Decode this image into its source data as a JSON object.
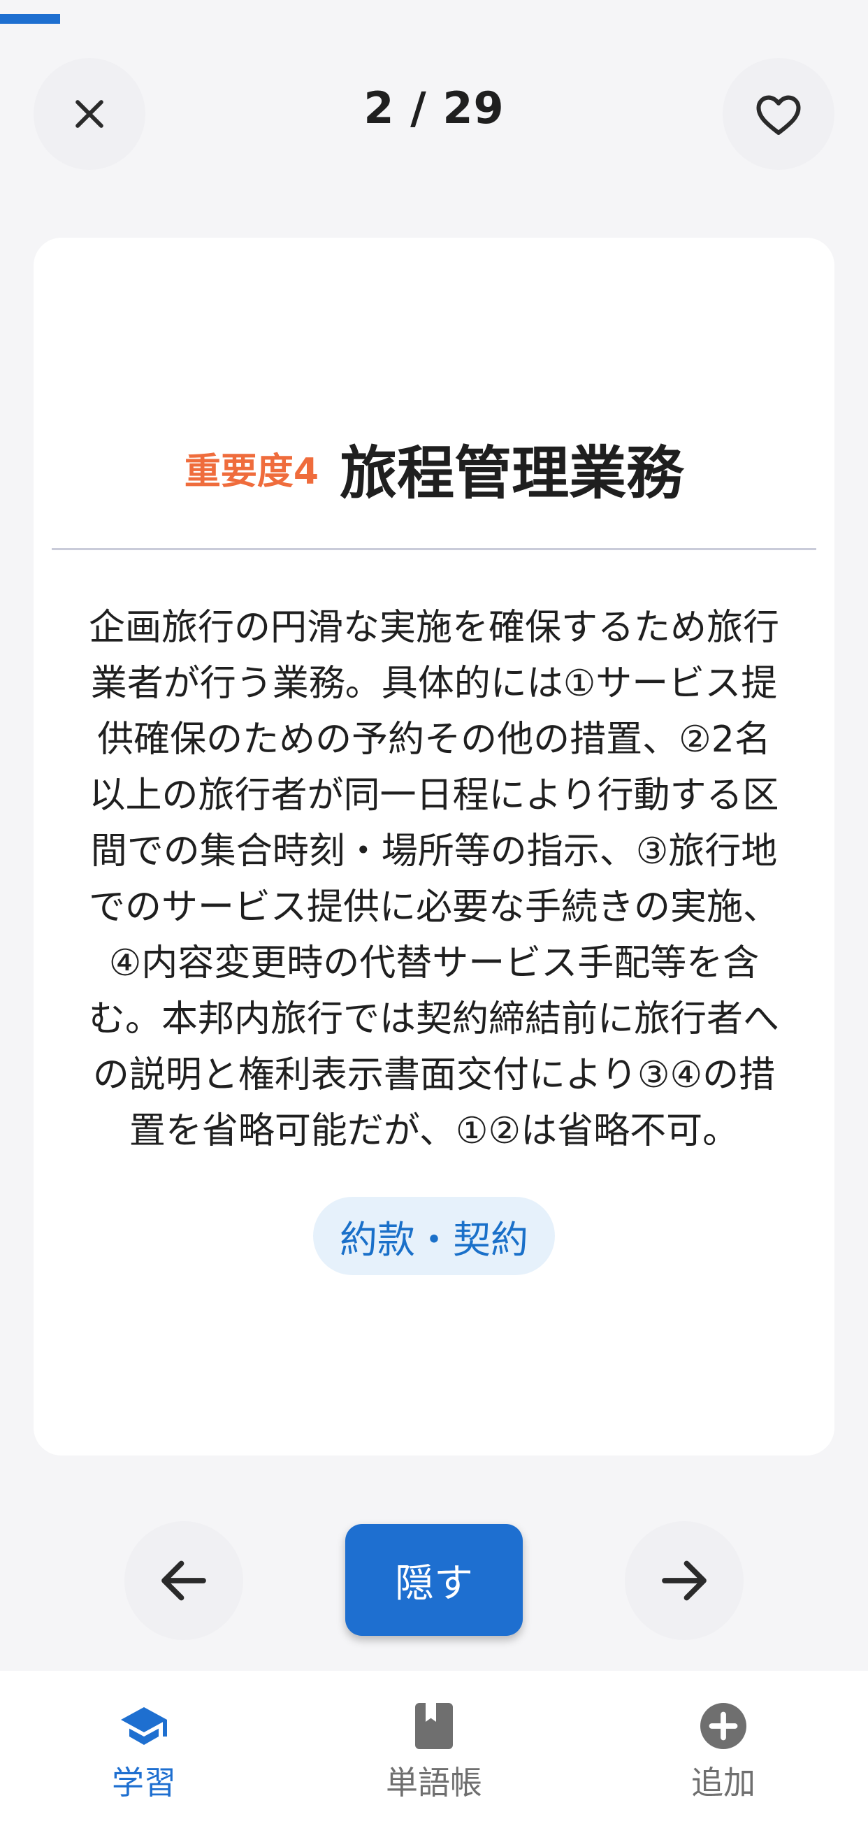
{
  "progress": {
    "current": 2,
    "total": 29,
    "fraction": 0.069
  },
  "header": {
    "counter": "2 / 29",
    "close_icon": "close-icon",
    "favorite_icon": "heart-outline-icon"
  },
  "card": {
    "importance": "重要度4",
    "term": "旅程管理業務",
    "definition_lines": [
      "企画旅行の円滑な実施を確保するため旅行",
      "業者が行う業務。具体的には①サービス提",
      "供確保のための予約その他の措置、②2名",
      "以上の旅行者が同一日程により行動する区",
      "間での集合時刻・場所等の指示、③旅行地",
      "でのサービス提供に必要な手続きの実施、",
      "④内容変更時の代替サービス手配等を含",
      "む。本邦内旅行では契約締結前に旅行者へ",
      "の説明と権利表示書面交付により③④の措",
      "置を省略可能だが、①②は省略不可。"
    ],
    "tag": "約款・契約"
  },
  "controls": {
    "prev_icon": "arrow-left-icon",
    "hide_label": "隠す",
    "next_icon": "arrow-right-icon"
  },
  "bottom_nav": {
    "items": [
      {
        "label": "学習",
        "icon": "graduation-cap-icon",
        "active": true
      },
      {
        "label": "単語帳",
        "icon": "book-icon",
        "active": false
      },
      {
        "label": "追加",
        "icon": "add-circle-icon",
        "active": false
      }
    ]
  },
  "colors": {
    "accent": "#1e6fd0",
    "importance": "#ef6c3c",
    "tag_bg": "#e6f1fb",
    "background": "#f5f5f7"
  }
}
